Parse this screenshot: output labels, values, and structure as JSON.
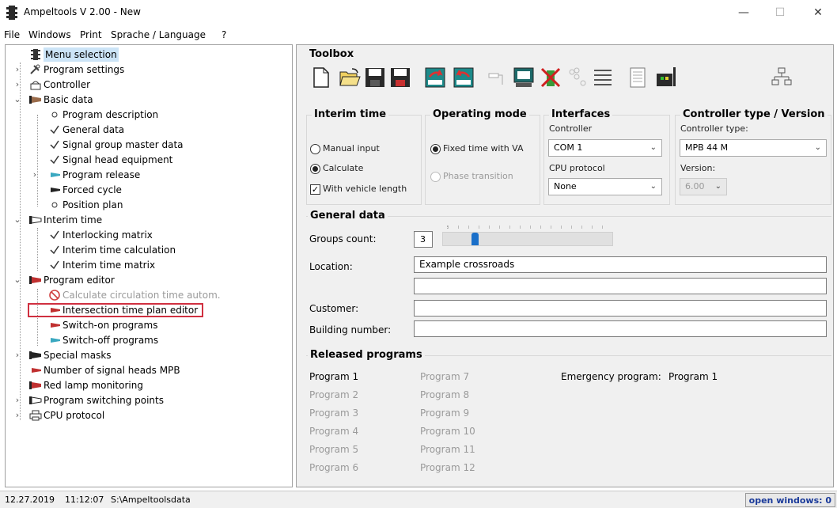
{
  "window": {
    "title": "Ampeltools V 2.00 - New",
    "minimize": "—",
    "maximize": "☐",
    "close": "✕"
  },
  "menu": [
    "File",
    "Windows",
    "Print",
    "Sprache / Language",
    "?"
  ],
  "tree": {
    "items": [
      {
        "label": "Menu selection",
        "icon": "traffic-light-icon",
        "selected": true
      },
      {
        "label": "Program settings",
        "icon": "tools-icon"
      },
      {
        "label": "Controller",
        "icon": "controller-icon"
      },
      {
        "label": "Basic data",
        "icon": "hand-pointer-icon"
      },
      {
        "label": "Program description",
        "icon": "circle-icon"
      },
      {
        "label": "General data",
        "icon": "checkmark-icon"
      },
      {
        "label": "Signal group master data",
        "icon": "checkmark-icon"
      },
      {
        "label": "Signal head equipment",
        "icon": "checkmark-icon"
      },
      {
        "label": "Program release",
        "icon": "hand-pointer-icon"
      },
      {
        "label": "Forced cycle",
        "icon": "hand-pointer-icon"
      },
      {
        "label": "Position plan",
        "icon": "circle-icon"
      },
      {
        "label": "Interim time",
        "icon": "hand-pointer-icon"
      },
      {
        "label": "Interlocking matrix",
        "icon": "checkmark-icon"
      },
      {
        "label": "Interim time calculation",
        "icon": "checkmark-icon"
      },
      {
        "label": "Interim time matrix",
        "icon": "checkmark-icon"
      },
      {
        "label": "Program editor",
        "icon": "hand-pointer-icon"
      },
      {
        "label": "Calculate circulation time autom.",
        "icon": "prohibited-icon",
        "disabled": true
      },
      {
        "label": "Intersection time plan editor",
        "icon": "hand-pointer-icon",
        "highlighted": true
      },
      {
        "label": "Switch-on programs",
        "icon": "hand-pointer-icon"
      },
      {
        "label": "Switch-off programs",
        "icon": "hand-pointer-icon"
      },
      {
        "label": "Special masks",
        "icon": "hand-pointer-icon"
      },
      {
        "label": "Number of signal heads MPB",
        "icon": "hand-pointer-icon"
      },
      {
        "label": "Red lamp monitoring",
        "icon": "hand-pointer-icon"
      },
      {
        "label": "Program switching points",
        "icon": "hand-pointer-icon"
      },
      {
        "label": "CPU protocol",
        "icon": "printer-icon"
      }
    ]
  },
  "toolbox": {
    "title": "Toolbox",
    "buttons": [
      "new-file-icon",
      "open-folder-icon",
      "save-icon",
      "save-as-icon",
      "export-icon",
      "import-icon",
      "connector-icon",
      "monitor-icon",
      "cancel-device-icon",
      "dots-icon",
      "list-icon",
      "document-icon",
      "controller-device-icon",
      "network-icon"
    ]
  },
  "interim_time": {
    "title": "Interim time",
    "manual": "Manual input",
    "calculate": "Calculate",
    "vehicle_length": "With vehicle length"
  },
  "operating_mode": {
    "title": "Operating mode",
    "fixed_time": "Fixed time with VA",
    "phase_transition": "Phase transition"
  },
  "interfaces": {
    "title": "Interfaces",
    "controller_label": "Controller",
    "controller_value": "COM 1",
    "cpu_label": "CPU protocol",
    "cpu_value": "None"
  },
  "controller_type": {
    "title": "Controller type / Version",
    "type_label": "Controller type:",
    "type_value": "MPB 44 M",
    "version_label": "Version:",
    "version_value": "6.00"
  },
  "general_data": {
    "title": "General data",
    "groups_count_label": "Groups count:",
    "groups_count_value": "3",
    "location_label": "Location:",
    "location_value": "Example crossroads",
    "location2_value": "",
    "customer_label": "Customer:",
    "customer_value": "",
    "building_label": "Building number:",
    "building_value": ""
  },
  "released_programs": {
    "title": "Released programs",
    "col1": [
      "Program 1",
      "Program 2",
      "Program 3",
      "Program 4",
      "Program 5",
      "Program 6"
    ],
    "col2": [
      "Program 7",
      "Program 8",
      "Program 9",
      "Program 10",
      "Program 11",
      "Program 12"
    ],
    "emergency_label": "Emergency program:",
    "emergency_value": "Program 1"
  },
  "status": {
    "date": "12.27.2019",
    "time": "11:12:07",
    "path": "S:\\Ampeltoolsdata",
    "open_windows": "open windows: 0"
  }
}
